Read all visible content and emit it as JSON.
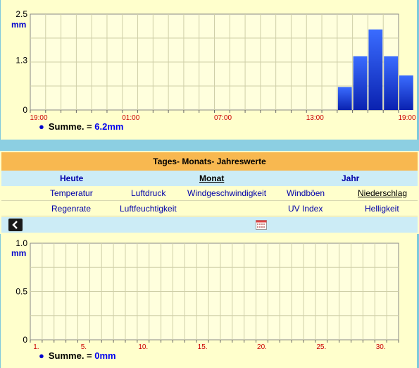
{
  "top_chart": {
    "unit": "mm",
    "y_ticks": [
      "2.5",
      "1.3",
      "0"
    ],
    "x_ticks": [
      "19:00",
      "01:00",
      "07:00",
      "13:00",
      "19:00"
    ],
    "summary_label": "Summe. =",
    "summary_value": "6.2mm",
    "colors": {
      "bar_top": "#3a6cff",
      "bar_bottom": "#0a22b0",
      "tick_x": "#cc0000",
      "tick_y": "#000000"
    }
  },
  "nav": {
    "header": "Tages- Monats- Jahreswerte",
    "periods": [
      "Heute",
      "Monat",
      "Jahr"
    ],
    "active_period": "Monat",
    "links_row1": [
      "Temperatur",
      "Luftdruck",
      "Windgeschwindigkeit",
      "Windböen",
      "Niederschlag"
    ],
    "links_row2": [
      "Regenrate",
      "Luftfeuchtigkeit",
      "UV Index",
      "Helligkeit"
    ],
    "active_link": "Niederschlag"
  },
  "bottom_chart": {
    "unit": "mm",
    "y_ticks": [
      "1.0",
      "0.5",
      "0"
    ],
    "x_ticks": [
      "1.",
      "5.",
      "10.",
      "15.",
      "20.",
      "25.",
      "30."
    ],
    "summary_label": "Summe. =",
    "summary_value": "0mm"
  },
  "chart_data": [
    {
      "type": "bar",
      "x": [
        "15:00",
        "16:00",
        "17:00",
        "18:00",
        "19:00"
      ],
      "values": [
        0.6,
        1.4,
        2.1,
        1.4,
        0.9
      ],
      "ylabel": "mm",
      "ylim": [
        0,
        2.5
      ],
      "grid": true
    },
    {
      "type": "bar",
      "x": [
        1,
        2,
        3,
        4,
        5,
        6,
        7,
        8,
        9,
        10,
        11,
        12,
        13,
        14,
        15,
        16,
        17,
        18,
        19,
        20,
        21,
        22,
        23,
        24,
        25,
        26,
        27,
        28,
        29,
        30,
        31
      ],
      "values": [
        0,
        0,
        0,
        0,
        0,
        0,
        0,
        0,
        0,
        0,
        0,
        0,
        0,
        0,
        0,
        0,
        0,
        0,
        0,
        0,
        0,
        0,
        0,
        0,
        0,
        0,
        0,
        0,
        0,
        0,
        0
      ],
      "ylabel": "mm",
      "ylim": [
        0,
        1.0
      ],
      "grid": true
    }
  ]
}
